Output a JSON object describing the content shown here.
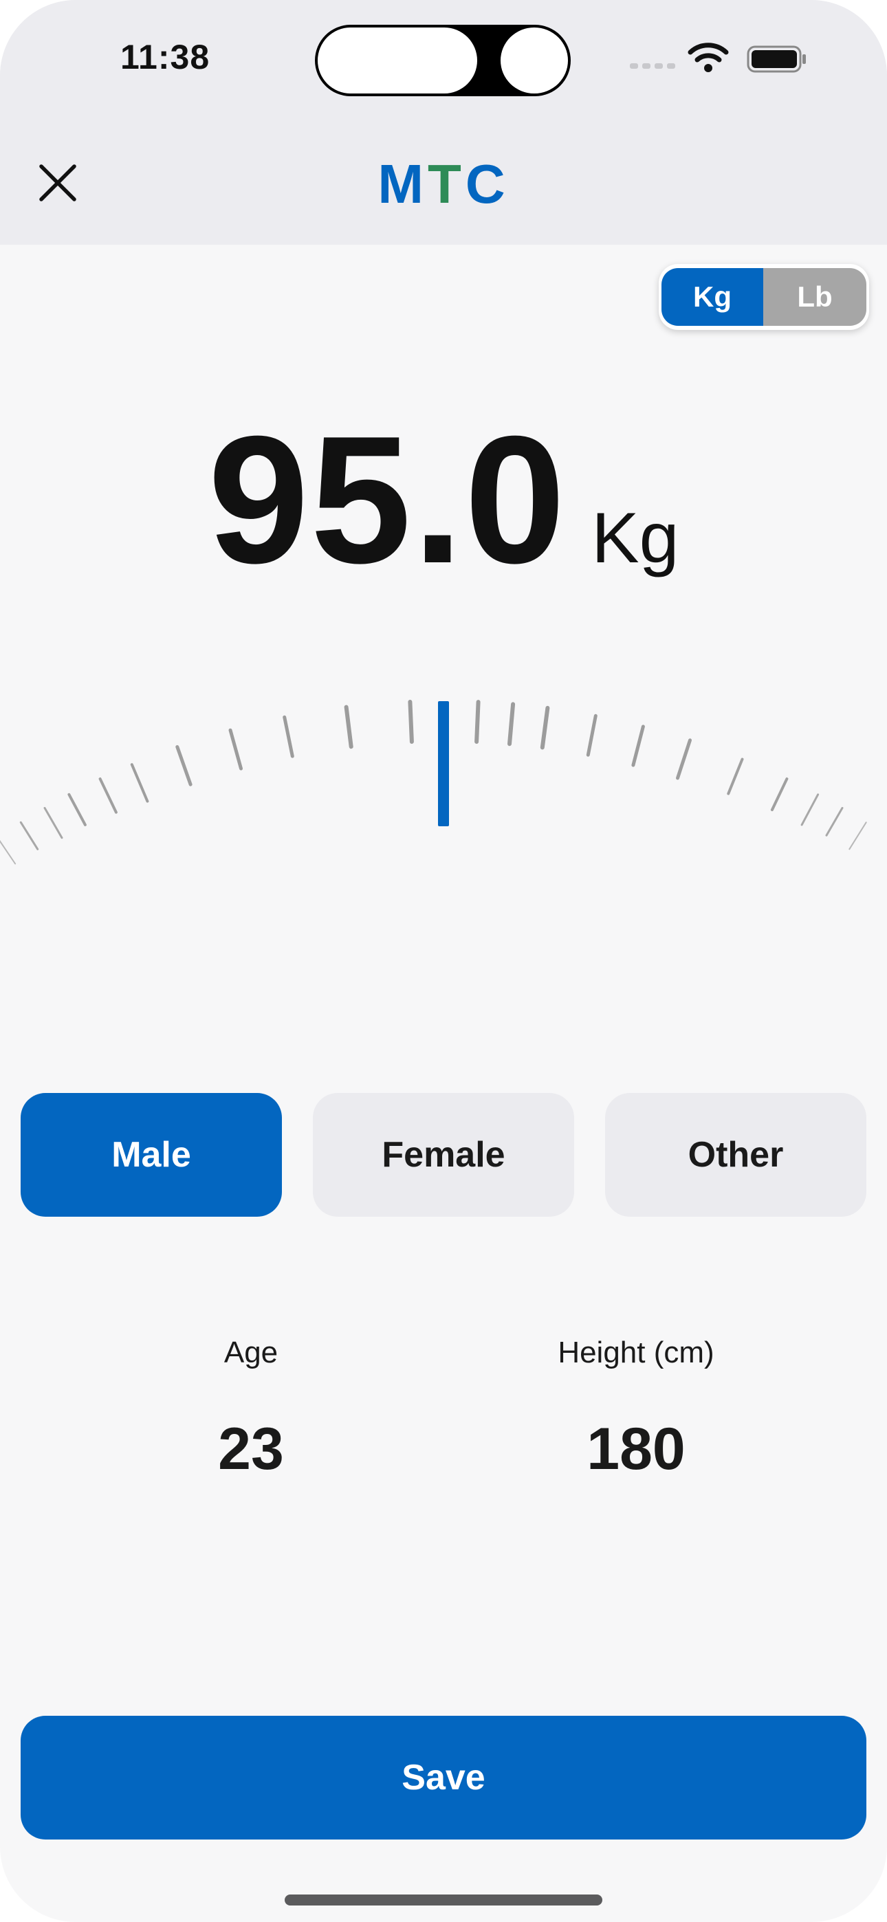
{
  "status_bar": {
    "time": "11:38"
  },
  "header": {
    "logo_letters": [
      {
        "char": "M",
        "color": "#0366c0"
      },
      {
        "char": "T",
        "color": "#2e8b57"
      },
      {
        "char": "C",
        "color": "#0366c0"
      }
    ],
    "close_icon": "close-icon"
  },
  "unit_toggle": {
    "options": [
      "Kg",
      "Lb"
    ],
    "selected": "Kg"
  },
  "weight": {
    "value": "95.0",
    "unit": "Kg"
  },
  "ruler": {
    "selected_value": 95.0
  },
  "gender": {
    "options": [
      "Male",
      "Female",
      "Other"
    ],
    "selected": "Male"
  },
  "stats": {
    "age_label": "Age",
    "age_value": "23",
    "height_label": "Height (cm)",
    "height_value": "180"
  },
  "actions": {
    "save_label": "Save"
  },
  "colors": {
    "accent": "#0366c0",
    "logo_green": "#2e8b57",
    "inactive_segment": "#a6a6a6",
    "inactive_button": "#ebebef"
  }
}
